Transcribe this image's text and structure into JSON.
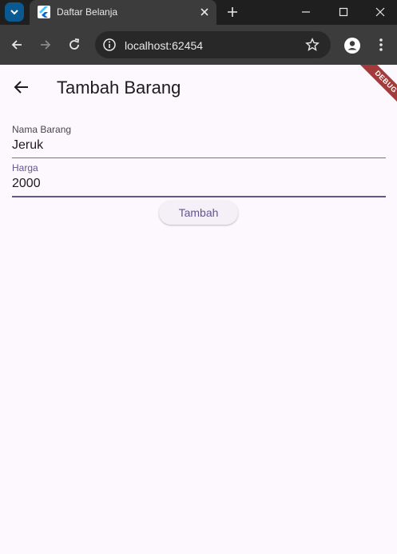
{
  "browser": {
    "tab_title": "Daftar Belanja",
    "url": "localhost:62454",
    "icons": {
      "tab_search": "chevron-down-icon",
      "favicon": "flutter-icon",
      "tab_close": "close-icon",
      "new_tab": "plus-icon",
      "minimize": "minimize-icon",
      "maximize": "maximize-icon",
      "close_window": "close-icon",
      "back": "arrow-left-icon",
      "forward": "arrow-right-icon",
      "reload": "reload-icon",
      "site_info": "info-icon",
      "bookmark": "star-icon",
      "profile": "person-icon",
      "menu": "more-vert-icon"
    }
  },
  "app": {
    "title": "Tambah Barang",
    "debug_label": "DEBUG",
    "back_icon": "arrow-back-icon",
    "fields": [
      {
        "label": "Nama Barang",
        "value": "Jeruk"
      },
      {
        "label": "Harga",
        "value": "2000"
      }
    ],
    "submit_label": "Tambah"
  },
  "colors": {
    "background": "#fdf7fe",
    "primary": "#65558f",
    "debug_ribbon": "#a33b3b",
    "chrome_dark": "#3c3c3c"
  }
}
